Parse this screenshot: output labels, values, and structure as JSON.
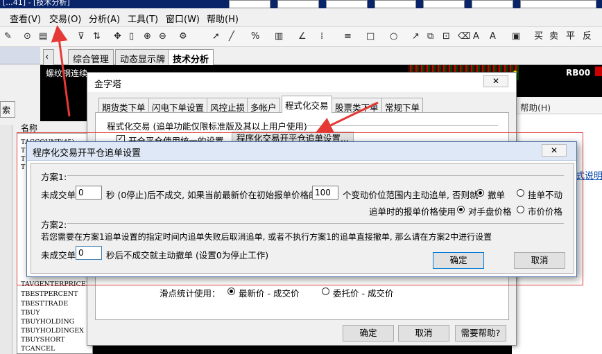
{
  "app": {
    "title_fragment": "[...41] - [技术分析]"
  },
  "menubar": {
    "items": [
      "查看(V)",
      "交易(O)",
      "分析(A)",
      "工具(T)",
      "窗口(W)",
      "帮助(H)"
    ]
  },
  "toolbar": {
    "text_buttons": [
      "买",
      "卖",
      "平",
      "反"
    ]
  },
  "workspace_tabs": [
    "综合管理",
    "动态显示牌",
    "技术分析"
  ],
  "chart_strip": {
    "symbol": "螺纹钢连续",
    "code": "RB00"
  },
  "left_dock": {
    "search_label": "索",
    "list_header": "名称",
    "items": [
      "TACCOUNT(45)",
      "TAVGENTERPRICEEX",
      "TBESTPERCENT",
      "TBESTTRADE",
      "TBUY",
      "TBUYHOLDING",
      "TBUYHOLDINGEX",
      "TBUYSHORT",
      "TCANCEL"
    ]
  },
  "right_area": {
    "help_menu": "帮助(H)",
    "link_text": "式说明"
  },
  "dialog_main": {
    "title": "金字塔",
    "close": "✕",
    "tabs": [
      "期货类下单",
      "闪电下单设置",
      "风控止损",
      "多帐户",
      "程式化交易",
      "股票类下单",
      "常规下单"
    ],
    "active_tab": "程式化交易",
    "section_label": "程式化交易 (追单功能仅限标准版及其以上用户使用)",
    "checkbox_label": "开仓平仓使用统一的设置",
    "checkbox_checked": true,
    "settings_button": "程序化交易开平仓追单设置...",
    "slippage_label": "滑点统计使用：",
    "slippage_options": [
      "最新价 - 成交价",
      "委托价 - 成交价"
    ],
    "slippage_selected": 0,
    "ok": "确定",
    "cancel": "取消",
    "help": "需要帮助?"
  },
  "dialog_chase": {
    "title": "程序化交易开平仓追单设置",
    "close": "✕",
    "plan1_title": "方案1:",
    "unfilled_label": "未成交单",
    "seconds_value": "0",
    "plan1_text": "秒 (0停止)后不成交, 如果当前最新价在初始报单价格的",
    "ticks_value": "100",
    "range_text": "个变动价位范围内主动追单, 否则就",
    "cancel_options": [
      "撤单",
      "挂单不动"
    ],
    "cancel_selected": 0,
    "price_label": "追单时的报单价格使用",
    "price_options": [
      "对手盘价格",
      "市价价格"
    ],
    "price_selected": 0,
    "plan2_title": "方案2:",
    "plan2_desc": "若您需要在方案1追单设置的指定时间内追单失败后取消追单, 或者不执行方案1的追单直接撤单, 那么请在方案2中进行设置",
    "unfilled_label2": "未成交单",
    "plan2_value": "0",
    "plan2_text": "秒后不成交就主动撤单 (设置0为停止工作)",
    "ok": "确定",
    "cancel": "取消"
  },
  "colors": {
    "annotation_red": "#e53935",
    "title_blue": "#0a246a"
  }
}
